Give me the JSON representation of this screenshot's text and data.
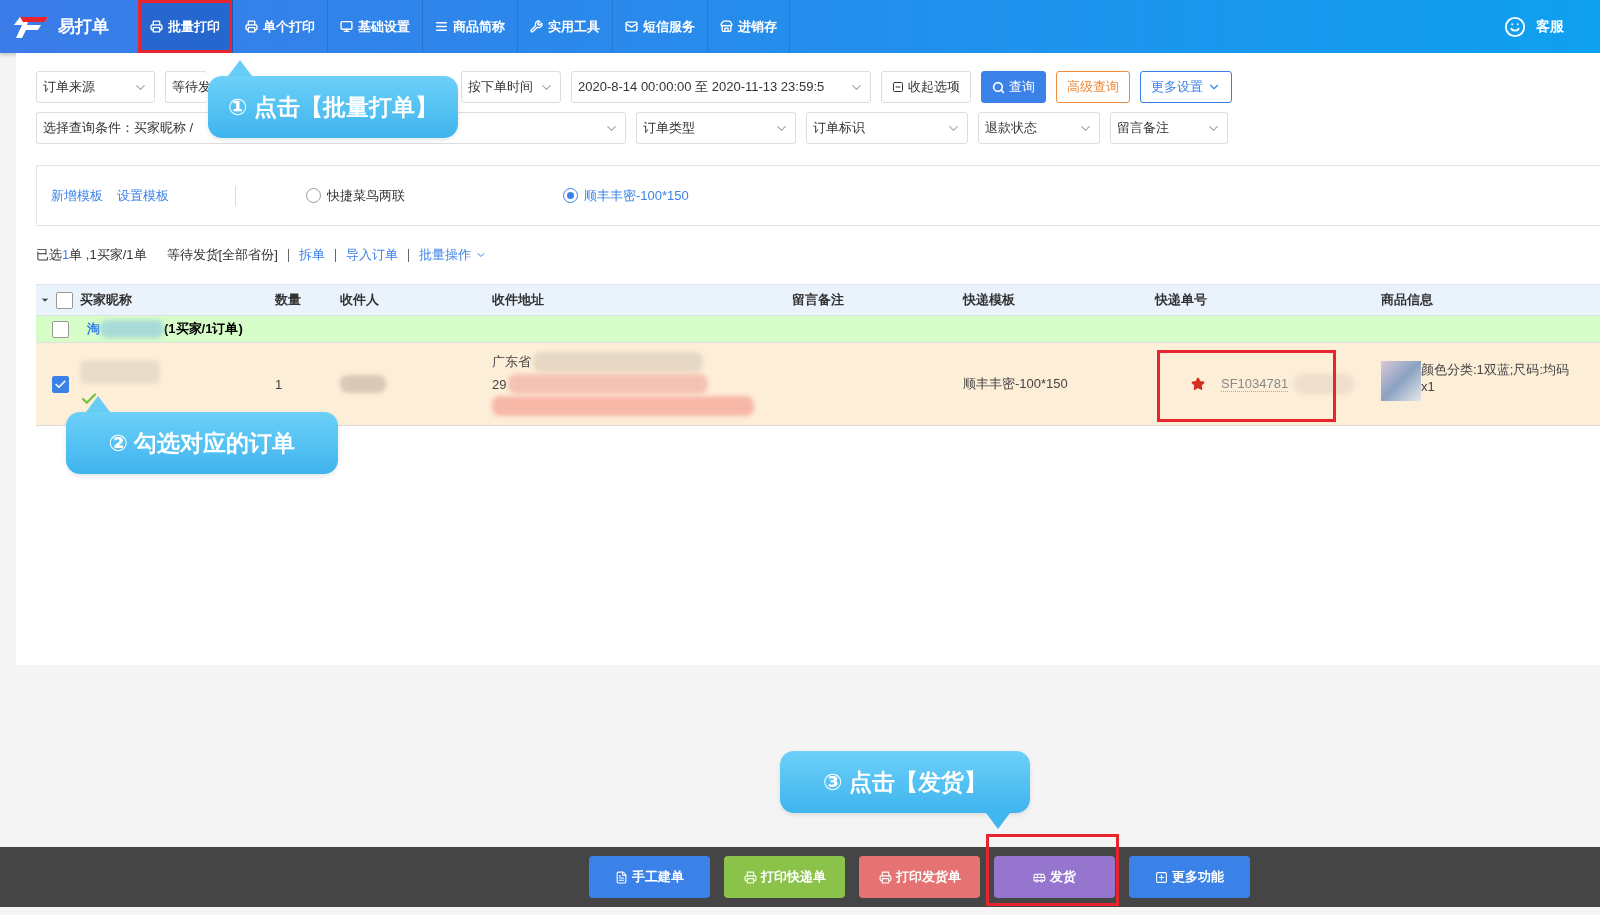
{
  "app": {
    "name": "易打单"
  },
  "nav": [
    {
      "label": "批量打印",
      "selected": true,
      "highlighted": true
    },
    {
      "label": "单个打印",
      "selected": false,
      "highlighted": false
    },
    {
      "label": "基础设置",
      "selected": false,
      "highlighted": false
    },
    {
      "label": "商品简称",
      "selected": false,
      "highlighted": false
    },
    {
      "label": "实用工具",
      "selected": false,
      "highlighted": false
    },
    {
      "label": "短信服务",
      "selected": false,
      "highlighted": false
    },
    {
      "label": "进销存",
      "selected": false,
      "highlighted": false
    }
  ],
  "support": {
    "label": "客服"
  },
  "filters_row1": [
    {
      "kind": "select",
      "value": "订单来源"
    },
    {
      "kind": "partial",
      "value": "等待发"
    },
    {
      "kind": "select",
      "value": "按下单时间"
    },
    {
      "kind": "date",
      "value": "2020-8-14 00:00:00 至 2020-11-13 23:59:5"
    },
    {
      "kind": "collapse",
      "value": "收起选项"
    },
    {
      "kind": "search",
      "value": "查询"
    },
    {
      "kind": "advanced",
      "value": "高级查询"
    },
    {
      "kind": "menu",
      "value": "更多设置"
    }
  ],
  "filters_row2": [
    {
      "kind": "select",
      "value": "选择查询条件：买家昵称 / "
    },
    {
      "kind": "select",
      "value": "订单类型"
    },
    {
      "kind": "select",
      "value": "订单标识"
    },
    {
      "kind": "select",
      "value": "退款状态"
    },
    {
      "kind": "select",
      "value": "留言备注"
    }
  ],
  "templates": {
    "links": [
      "新增模板",
      "设置模板"
    ],
    "options": [
      {
        "label": "快捷菜鸟两联",
        "selected": false
      },
      {
        "label": "顺丰丰密-100*150",
        "selected": true
      }
    ]
  },
  "summary": {
    "selected_prefix": "已选",
    "selected_count": "1",
    "selected_suffix": "单 ,1买家/1单",
    "status": "等待发货[全部省份]",
    "actions": [
      "拆单",
      "导入订单",
      "批量操作"
    ]
  },
  "table": {
    "select_all_checked": false,
    "columns": [
      "买家昵称",
      "数量",
      "收件人",
      "收件地址",
      "留言备注",
      "快递模板",
      "快递单号",
      "商品信息"
    ],
    "groups": [
      {
        "shop": "淘",
        "summary": "(1买家/1订单)",
        "checked": false,
        "rows": [
          {
            "checked": true,
            "quantity": "1",
            "address_lines": [
              "广东省",
              "29"
            ],
            "template": "顺丰丰密-100*150",
            "tracking": "SF1034781",
            "tracking_highlighted": true,
            "product": "颜色分类:1双蓝;尺码:均码",
            "product_qty": "x1"
          }
        ]
      }
    ]
  },
  "callouts": [
    {
      "text": "① 点击【批量打单】"
    },
    {
      "text": "② 勾选对应的订单"
    },
    {
      "text": "③ 点击【发货】"
    }
  ],
  "footer_buttons": [
    {
      "label": "手工建单",
      "color": "#3b82e8",
      "highlighted": false
    },
    {
      "label": "打印快递单",
      "color": "#8bc34a",
      "highlighted": false
    },
    {
      "label": "打印发货单",
      "color": "#e57373",
      "highlighted": false
    },
    {
      "label": "发货",
      "color": "#9575cd",
      "highlighted": true
    },
    {
      "label": "更多功能",
      "color": "#3b82e8",
      "highlighted": false
    }
  ]
}
